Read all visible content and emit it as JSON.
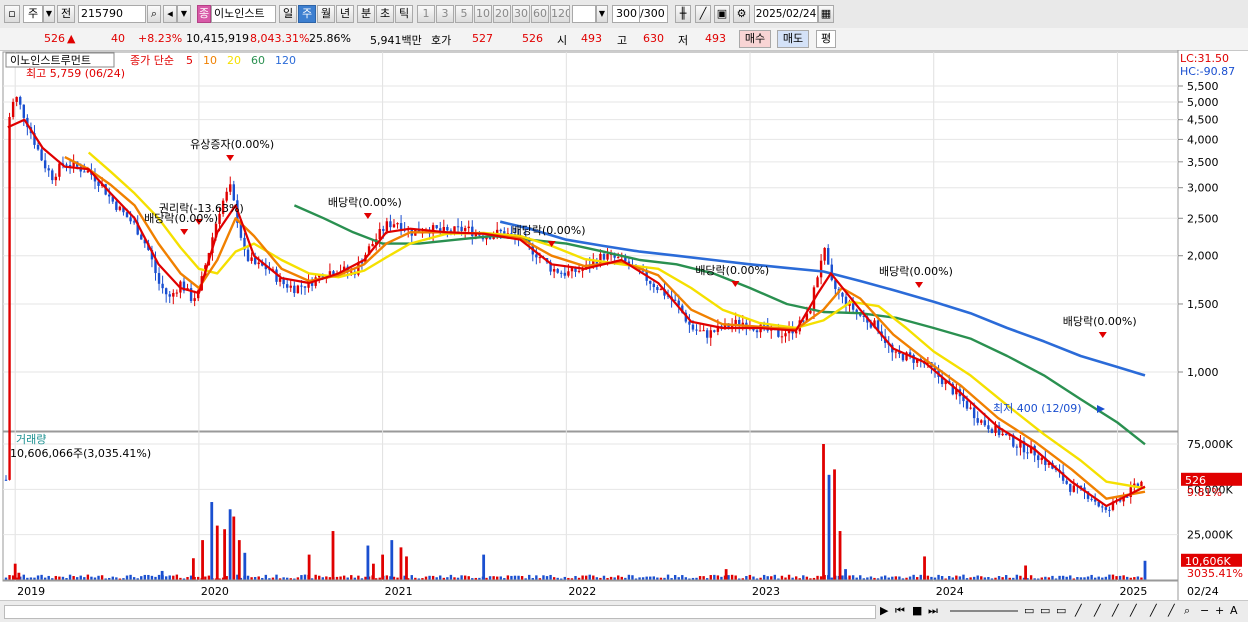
{
  "toolbar": {
    "market": "주",
    "prev_label": "전",
    "code": "215790",
    "tag": "종",
    "name": "이노인스트",
    "periods": [
      "일",
      "주",
      "월",
      "년",
      "분",
      "초",
      "틱"
    ],
    "active_period": "주",
    "minutes": [
      "1",
      "3",
      "5",
      "10",
      "20",
      "30",
      "60",
      "120"
    ],
    "count": "300",
    "count_total": "/300",
    "date": "2025/02/24"
  },
  "quote": {
    "price": "526",
    "change_arrow": "▲",
    "change": "40",
    "change_pct": "+8.23%",
    "volume": "10,415,919",
    "volume_pct": "8,043.31%",
    "turnover": "25.86%",
    "amount": "5,941백만",
    "hoga_label": "호가",
    "ask": "527",
    "bid": "526",
    "open_label": "시",
    "open": "493",
    "high_label": "고",
    "high": "630",
    "low_label": "저",
    "low": "493",
    "buy": "매수",
    "sell": "매도",
    "eval": "평"
  },
  "colors": {
    "up": "#e00000",
    "down": "#1a4fd0",
    "ma5": "#e00000",
    "ma10": "#f08000",
    "ma20": "#f5e000",
    "ma60": "#2a9050",
    "ma120": "#2b6bd8",
    "volume_label": "#1a9090"
  },
  "chart_data": {
    "type": "line",
    "title": "이노인스트루먼트",
    "legend_prefix": "종가 단순",
    "legend": [
      "5",
      "10",
      "20",
      "60",
      "120"
    ],
    "x_labels": [
      "2019",
      "2020",
      "2021",
      "2022",
      "2023",
      "2024",
      "2025",
      "02/24"
    ],
    "price_axis": {
      "ticks": [
        "5,500",
        "5,000",
        "4,500",
        "4,000",
        "3,500",
        "3,000",
        "2,500",
        "2,000",
        "1,500",
        "1,000"
      ],
      "ylim": [
        390,
        5940
      ]
    },
    "price_top_labels": [
      "LC:31.50",
      "HC:-90.87"
    ],
    "price_now_label": "526",
    "price_now_pct": "9.81%",
    "max_label": "최고 5,759 (06/24)",
    "min_label": "최저 400 (12/09)",
    "annotations": [
      {
        "text": "유상증자(0.00%)",
        "x": 2020.17
      },
      {
        "text": "권리락(-13.63%)",
        "x": 2020.0
      },
      {
        "text": "배당락(0.00%)",
        "x": 2019.92
      },
      {
        "text": "배당락(0.00%)",
        "x": 2020.92
      },
      {
        "text": "배당락(0.00%)",
        "x": 2021.92
      },
      {
        "text": "배당락(0.00%)",
        "x": 2022.92
      },
      {
        "text": "배당락(0.00%)",
        "x": 2023.92
      },
      {
        "text": "배당락(0.00%)",
        "x": 2024.92
      }
    ],
    "close_points": [
      [
        2018.96,
        4400
      ],
      [
        2019.0,
        5200
      ],
      [
        2019.05,
        4600
      ],
      [
        2019.1,
        4000
      ],
      [
        2019.15,
        3500
      ],
      [
        2019.2,
        3200
      ],
      [
        2019.27,
        3500
      ],
      [
        2019.33,
        3400
      ],
      [
        2019.4,
        3300
      ],
      [
        2019.46,
        3100
      ],
      [
        2019.52,
        2800
      ],
      [
        2019.58,
        2600
      ],
      [
        2019.65,
        2400
      ],
      [
        2019.72,
        2100
      ],
      [
        2019.78,
        1700
      ],
      [
        2019.84,
        1550
      ],
      [
        2019.9,
        1700
      ],
      [
        2019.96,
        1550
      ],
      [
        2020.0,
        1600
      ],
      [
        2020.06,
        2100
      ],
      [
        2020.12,
        2700
      ],
      [
        2020.17,
        3000
      ],
      [
        2020.2,
        2600
      ],
      [
        2020.25,
        2000
      ],
      [
        2020.3,
        1900
      ],
      [
        2020.38,
        1850
      ],
      [
        2020.45,
        1700
      ],
      [
        2020.52,
        1650
      ],
      [
        2020.6,
        1700
      ],
      [
        2020.68,
        1800
      ],
      [
        2020.76,
        1850
      ],
      [
        2020.84,
        1800
      ],
      [
        2020.9,
        2000
      ],
      [
        2020.96,
        2200
      ],
      [
        2021.02,
        2400
      ],
      [
        2021.08,
        2450
      ],
      [
        2021.15,
        2300
      ],
      [
        2021.25,
        2350
      ],
      [
        2021.35,
        2300
      ],
      [
        2021.45,
        2350
      ],
      [
        2021.55,
        2250
      ],
      [
        2021.65,
        2300
      ],
      [
        2021.75,
        2200
      ],
      [
        2021.85,
        2000
      ],
      [
        2021.92,
        1850
      ],
      [
        2022.0,
        1800
      ],
      [
        2022.1,
        1850
      ],
      [
        2022.2,
        2000
      ],
      [
        2022.3,
        1950
      ],
      [
        2022.4,
        1800
      ],
      [
        2022.5,
        1650
      ],
      [
        2022.6,
        1500
      ],
      [
        2022.68,
        1300
      ],
      [
        2022.76,
        1250
      ],
      [
        2022.85,
        1300
      ],
      [
        2022.95,
        1350
      ],
      [
        2023.05,
        1300
      ],
      [
        2023.15,
        1250
      ],
      [
        2023.25,
        1300
      ],
      [
        2023.32,
        1400
      ],
      [
        2023.37,
        1800
      ],
      [
        2023.4,
        2100
      ],
      [
        2023.44,
        1700
      ],
      [
        2023.5,
        1550
      ],
      [
        2023.6,
        1400
      ],
      [
        2023.7,
        1300
      ],
      [
        2023.78,
        1100
      ],
      [
        2023.85,
        1100
      ],
      [
        2023.95,
        1050
      ],
      [
        2024.05,
        950
      ],
      [
        2024.15,
        850
      ],
      [
        2024.25,
        750
      ],
      [
        2024.35,
        700
      ],
      [
        2024.45,
        650
      ],
      [
        2024.55,
        620
      ],
      [
        2024.65,
        560
      ],
      [
        2024.75,
        500
      ],
      [
        2024.85,
        480
      ],
      [
        2024.94,
        430
      ],
      [
        2025.0,
        470
      ],
      [
        2025.07,
        490
      ],
      [
        2025.15,
        526
      ]
    ],
    "ma_series": [
      {
        "name": "5",
        "points": [
          [
            2018.96,
            4300
          ],
          [
            2019.05,
            4500
          ],
          [
            2019.15,
            3800
          ],
          [
            2019.27,
            3400
          ],
          [
            2019.4,
            3350
          ],
          [
            2019.52,
            2900
          ],
          [
            2019.65,
            2500
          ],
          [
            2019.78,
            1900
          ],
          [
            2019.9,
            1650
          ],
          [
            2020.0,
            1600
          ],
          [
            2020.1,
            2300
          ],
          [
            2020.2,
            2700
          ],
          [
            2020.3,
            2000
          ],
          [
            2020.45,
            1750
          ],
          [
            2020.6,
            1700
          ],
          [
            2020.76,
            1800
          ],
          [
            2020.9,
            1950
          ],
          [
            2021.02,
            2300
          ],
          [
            2021.15,
            2350
          ],
          [
            2021.35,
            2300
          ],
          [
            2021.55,
            2280
          ],
          [
            2021.75,
            2200
          ],
          [
            2021.92,
            1900
          ],
          [
            2022.1,
            1850
          ],
          [
            2022.3,
            1950
          ],
          [
            2022.5,
            1700
          ],
          [
            2022.68,
            1350
          ],
          [
            2022.85,
            1300
          ],
          [
            2023.05,
            1300
          ],
          [
            2023.25,
            1280
          ],
          [
            2023.37,
            1600
          ],
          [
            2023.44,
            1800
          ],
          [
            2023.6,
            1450
          ],
          [
            2023.78,
            1150
          ],
          [
            2023.95,
            1060
          ],
          [
            2024.15,
            880
          ],
          [
            2024.35,
            720
          ],
          [
            2024.55,
            630
          ],
          [
            2024.75,
            520
          ],
          [
            2024.94,
            450
          ],
          [
            2025.15,
            505
          ]
        ]
      },
      {
        "name": "10",
        "points": [
          [
            2019.27,
            3600
          ],
          [
            2019.4,
            3350
          ],
          [
            2019.52,
            3050
          ],
          [
            2019.65,
            2700
          ],
          [
            2019.78,
            2150
          ],
          [
            2019.9,
            1800
          ],
          [
            2020.0,
            1650
          ],
          [
            2020.1,
            1950
          ],
          [
            2020.2,
            2500
          ],
          [
            2020.3,
            2250
          ],
          [
            2020.45,
            1850
          ],
          [
            2020.6,
            1720
          ],
          [
            2020.76,
            1780
          ],
          [
            2020.9,
            1900
          ],
          [
            2021.02,
            2150
          ],
          [
            2021.15,
            2300
          ],
          [
            2021.35,
            2300
          ],
          [
            2021.55,
            2280
          ],
          [
            2021.75,
            2220
          ],
          [
            2021.92,
            2000
          ],
          [
            2022.1,
            1880
          ],
          [
            2022.3,
            1930
          ],
          [
            2022.5,
            1780
          ],
          [
            2022.68,
            1450
          ],
          [
            2022.85,
            1330
          ],
          [
            2023.05,
            1310
          ],
          [
            2023.25,
            1290
          ],
          [
            2023.4,
            1450
          ],
          [
            2023.5,
            1650
          ],
          [
            2023.6,
            1550
          ],
          [
            2023.78,
            1250
          ],
          [
            2023.95,
            1080
          ],
          [
            2024.15,
            920
          ],
          [
            2024.35,
            760
          ],
          [
            2024.55,
            660
          ],
          [
            2024.75,
            560
          ],
          [
            2024.94,
            470
          ],
          [
            2025.15,
            490
          ]
        ]
      },
      {
        "name": "20",
        "points": [
          [
            2019.4,
            3700
          ],
          [
            2019.52,
            3300
          ],
          [
            2019.65,
            2900
          ],
          [
            2019.78,
            2500
          ],
          [
            2019.9,
            2100
          ],
          [
            2020.0,
            1850
          ],
          [
            2020.1,
            1800
          ],
          [
            2020.2,
            2050
          ],
          [
            2020.3,
            2150
          ],
          [
            2020.45,
            1950
          ],
          [
            2020.6,
            1800
          ],
          [
            2020.76,
            1760
          ],
          [
            2020.9,
            1830
          ],
          [
            2021.02,
            1980
          ],
          [
            2021.15,
            2150
          ],
          [
            2021.35,
            2280
          ],
          [
            2021.55,
            2290
          ],
          [
            2021.75,
            2250
          ],
          [
            2021.92,
            2120
          ],
          [
            2022.1,
            1960
          ],
          [
            2022.3,
            1900
          ],
          [
            2022.5,
            1850
          ],
          [
            2022.68,
            1650
          ],
          [
            2022.85,
            1450
          ],
          [
            2023.05,
            1340
          ],
          [
            2023.25,
            1300
          ],
          [
            2023.4,
            1360
          ],
          [
            2023.55,
            1520
          ],
          [
            2023.7,
            1480
          ],
          [
            2023.85,
            1300
          ],
          [
            2024.0,
            1130
          ],
          [
            2024.2,
            980
          ],
          [
            2024.4,
            820
          ],
          [
            2024.6,
            690
          ],
          [
            2024.8,
            590
          ],
          [
            2024.94,
            520
          ],
          [
            2025.15,
            500
          ]
        ]
      },
      {
        "name": "60",
        "points": [
          [
            2020.52,
            2700
          ],
          [
            2020.68,
            2500
          ],
          [
            2020.84,
            2300
          ],
          [
            2021.0,
            2150
          ],
          [
            2021.2,
            2150
          ],
          [
            2021.4,
            2200
          ],
          [
            2021.6,
            2250
          ],
          [
            2021.8,
            2200
          ],
          [
            2022.0,
            2150
          ],
          [
            2022.2,
            2050
          ],
          [
            2022.4,
            1950
          ],
          [
            2022.6,
            1900
          ],
          [
            2022.8,
            1800
          ],
          [
            2023.0,
            1650
          ],
          [
            2023.2,
            1500
          ],
          [
            2023.4,
            1430
          ],
          [
            2023.6,
            1420
          ],
          [
            2023.8,
            1380
          ],
          [
            2024.0,
            1300
          ],
          [
            2024.2,
            1220
          ],
          [
            2024.4,
            1100
          ],
          [
            2024.6,
            980
          ],
          [
            2024.8,
            850
          ],
          [
            2025.0,
            740
          ],
          [
            2025.15,
            650
          ]
        ]
      },
      {
        "name": "120",
        "points": [
          [
            2021.64,
            2450
          ],
          [
            2021.8,
            2350
          ],
          [
            2022.0,
            2200
          ],
          [
            2022.2,
            2120
          ],
          [
            2022.4,
            2050
          ],
          [
            2022.6,
            2000
          ],
          [
            2022.8,
            1950
          ],
          [
            2023.0,
            1900
          ],
          [
            2023.2,
            1860
          ],
          [
            2023.4,
            1820
          ],
          [
            2023.6,
            1720
          ],
          [
            2023.8,
            1620
          ],
          [
            2024.0,
            1520
          ],
          [
            2024.2,
            1420
          ],
          [
            2024.4,
            1300
          ],
          [
            2024.6,
            1200
          ],
          [
            2024.8,
            1100
          ],
          [
            2025.0,
            1030
          ],
          [
            2025.15,
            980
          ]
        ]
      }
    ],
    "volume_axis": {
      "ticks": [
        "75,000K",
        "50,000K",
        "25,000K"
      ],
      "ylim": [
        0,
        80000
      ]
    },
    "volume_title": "거래량",
    "volume_info": "10,606,066주(3,035.41%)",
    "volume_now_label": "10,606K",
    "volume_now_pct": "3035.41%",
    "volume_spikes": [
      [
        2019.0,
        9000
      ],
      [
        2019.02,
        4000
      ],
      [
        2019.8,
        5000
      ],
      [
        2019.97,
        12000
      ],
      [
        2020.02,
        22000
      ],
      [
        2020.07,
        43000
      ],
      [
        2020.1,
        30000
      ],
      [
        2020.14,
        28000
      ],
      [
        2020.17,
        39000
      ],
      [
        2020.19,
        35000
      ],
      [
        2020.22,
        22000
      ],
      [
        2020.25,
        15000
      ],
      [
        2020.6,
        14000
      ],
      [
        2020.73,
        27000
      ],
      [
        2020.92,
        19000
      ],
      [
        2020.95,
        9000
      ],
      [
        2021.0,
        14000
      ],
      [
        2021.05,
        22000
      ],
      [
        2021.1,
        18000
      ],
      [
        2021.13,
        13000
      ],
      [
        2021.55,
        14000
      ],
      [
        2022.87,
        6000
      ],
      [
        2023.4,
        75000
      ],
      [
        2023.43,
        58000
      ],
      [
        2023.46,
        61000
      ],
      [
        2023.49,
        27000
      ],
      [
        2023.52,
        6000
      ],
      [
        2023.95,
        13000
      ],
      [
        2024.5,
        8000
      ],
      [
        2025.15,
        10606
      ]
    ]
  }
}
